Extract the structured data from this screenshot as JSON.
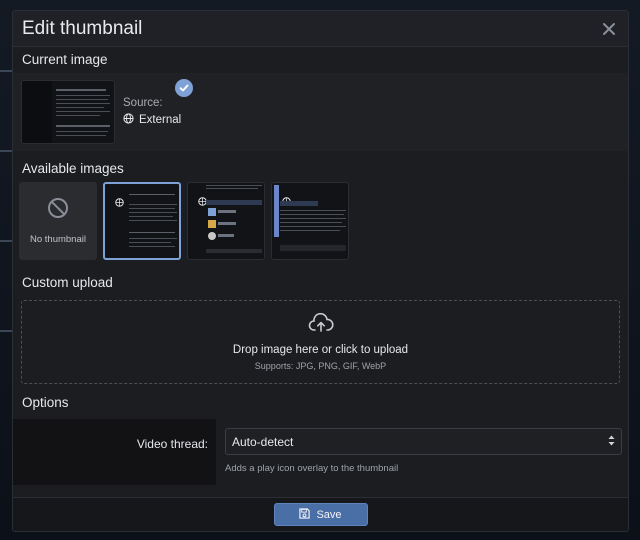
{
  "dialog": {
    "title": "Edit thumbnail",
    "close_icon": "close-icon"
  },
  "current_image": {
    "section_title": "Current image",
    "source_label": "Source:",
    "source_value": "External",
    "source_icon": "globe-icon"
  },
  "available_images": {
    "section_title": "Available images",
    "no_thumbnail_label": "No thumbnail",
    "no_thumbnail_icon": "ban-icon",
    "selected_index": 1,
    "check_icon": "check-icon"
  },
  "custom_upload": {
    "section_title": "Custom upload",
    "upload_icon": "cloud-upload-icon",
    "main_text": "Drop image here or click to upload",
    "sub_text": "Supports: JPG, PNG, GIF, WebP"
  },
  "options": {
    "section_title": "Options",
    "video_thread_label": "Video thread:",
    "video_thread_value": "Auto-detect",
    "video_thread_hint": "Adds a play icon overlay to the thumbnail"
  },
  "footer": {
    "save_label": "Save",
    "save_icon": "floppy-disk-icon"
  },
  "colors": {
    "accent": "#4a6ea6",
    "selected_border": "#7ea2d6",
    "dialog_bg": "#1c1d20"
  }
}
